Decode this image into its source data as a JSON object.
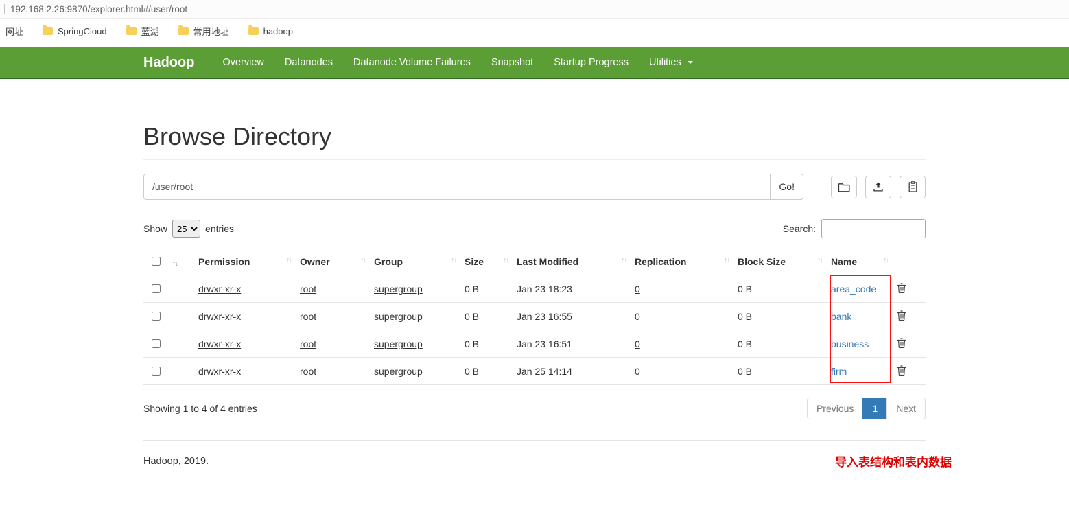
{
  "colors": {
    "navbar": "#5b9e35",
    "link": "#337ab7",
    "annotation": "#e00000",
    "highlight": "#ff1010"
  },
  "browser": {
    "url": "192.168.2.26:9870/explorer.html#/user/root",
    "bookmarks": [
      "网址",
      "SpringCloud",
      "蓝湖",
      "常用地址",
      "hadoop"
    ]
  },
  "navbar": {
    "brand": "Hadoop",
    "items": [
      "Overview",
      "Datanodes",
      "Datanode Volume Failures",
      "Snapshot",
      "Startup Progress",
      "Utilities"
    ]
  },
  "main": {
    "title": "Browse Directory",
    "path_value": "/user/root",
    "go_label": "Go!",
    "show_label": "Show",
    "entries_selected": "25",
    "entries_label": "entries",
    "search_label": "Search:",
    "icons": {
      "sort": "↑↓"
    },
    "table": {
      "headers": [
        "Permission",
        "Owner",
        "Group",
        "Size",
        "Last Modified",
        "Replication",
        "Block Size",
        "Name"
      ],
      "rows": [
        {
          "permission": "drwxr-xr-x",
          "owner": "root",
          "group": "supergroup",
          "size": "0 B",
          "modified": "Jan 23 18:23",
          "replication": "0",
          "block_size": "0 B",
          "name": "area_code"
        },
        {
          "permission": "drwxr-xr-x",
          "owner": "root",
          "group": "supergroup",
          "size": "0 B",
          "modified": "Jan 23 16:55",
          "replication": "0",
          "block_size": "0 B",
          "name": "bank"
        },
        {
          "permission": "drwxr-xr-x",
          "owner": "root",
          "group": "supergroup",
          "size": "0 B",
          "modified": "Jan 23 16:51",
          "replication": "0",
          "block_size": "0 B",
          "name": "business"
        },
        {
          "permission": "drwxr-xr-x",
          "owner": "root",
          "group": "supergroup",
          "size": "0 B",
          "modified": "Jan 25 14:14",
          "replication": "0",
          "block_size": "0 B",
          "name": "firm"
        }
      ]
    },
    "showing_text": "Showing 1 to 4 of 4 entries",
    "pagination": {
      "previous": "Previous",
      "page": "1",
      "next": "Next"
    },
    "footer": "Hadoop, 2019.",
    "annotation": "导入表结构和表内数据"
  }
}
